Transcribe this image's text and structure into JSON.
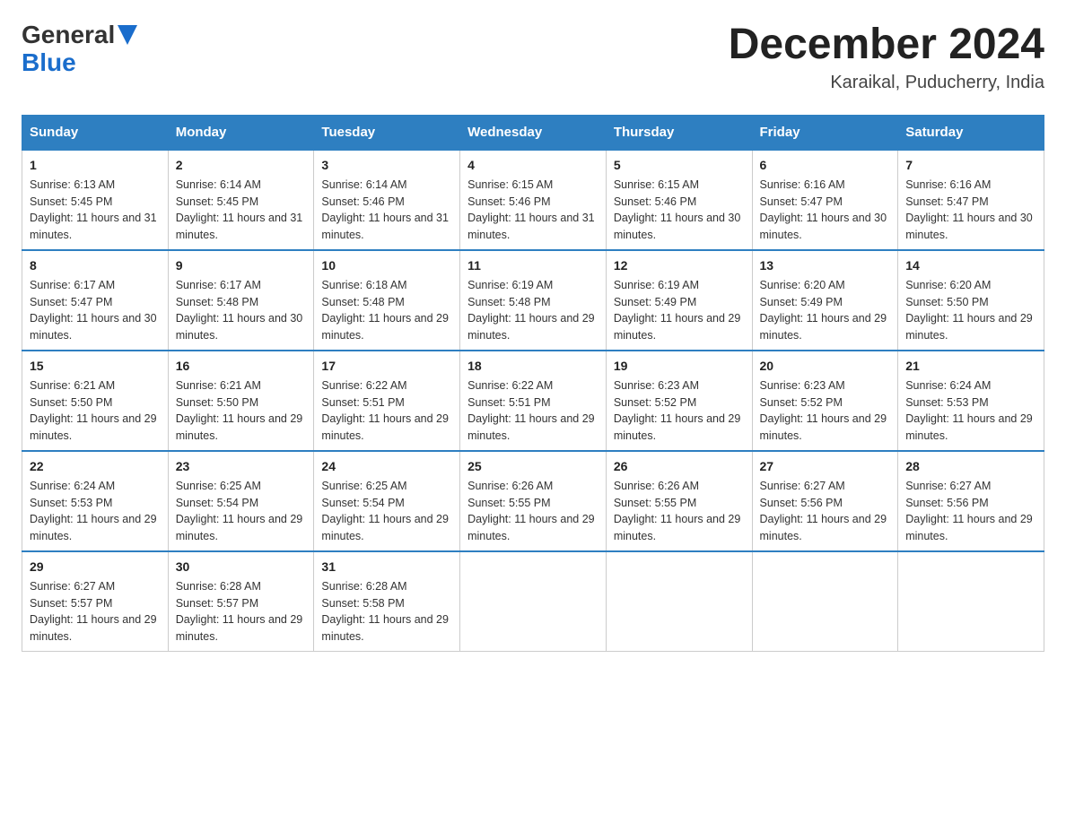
{
  "header": {
    "logo_general": "General",
    "logo_blue": "Blue",
    "month_title": "December 2024",
    "location": "Karaikal, Puducherry, India"
  },
  "days_of_week": [
    "Sunday",
    "Monday",
    "Tuesday",
    "Wednesday",
    "Thursday",
    "Friday",
    "Saturday"
  ],
  "weeks": [
    [
      {
        "day": "1",
        "sunrise": "6:13 AM",
        "sunset": "5:45 PM",
        "daylight": "11 hours and 31 minutes."
      },
      {
        "day": "2",
        "sunrise": "6:14 AM",
        "sunset": "5:45 PM",
        "daylight": "11 hours and 31 minutes."
      },
      {
        "day": "3",
        "sunrise": "6:14 AM",
        "sunset": "5:46 PM",
        "daylight": "11 hours and 31 minutes."
      },
      {
        "day": "4",
        "sunrise": "6:15 AM",
        "sunset": "5:46 PM",
        "daylight": "11 hours and 31 minutes."
      },
      {
        "day": "5",
        "sunrise": "6:15 AM",
        "sunset": "5:46 PM",
        "daylight": "11 hours and 30 minutes."
      },
      {
        "day": "6",
        "sunrise": "6:16 AM",
        "sunset": "5:47 PM",
        "daylight": "11 hours and 30 minutes."
      },
      {
        "day": "7",
        "sunrise": "6:16 AM",
        "sunset": "5:47 PM",
        "daylight": "11 hours and 30 minutes."
      }
    ],
    [
      {
        "day": "8",
        "sunrise": "6:17 AM",
        "sunset": "5:47 PM",
        "daylight": "11 hours and 30 minutes."
      },
      {
        "day": "9",
        "sunrise": "6:17 AM",
        "sunset": "5:48 PM",
        "daylight": "11 hours and 30 minutes."
      },
      {
        "day": "10",
        "sunrise": "6:18 AM",
        "sunset": "5:48 PM",
        "daylight": "11 hours and 29 minutes."
      },
      {
        "day": "11",
        "sunrise": "6:19 AM",
        "sunset": "5:48 PM",
        "daylight": "11 hours and 29 minutes."
      },
      {
        "day": "12",
        "sunrise": "6:19 AM",
        "sunset": "5:49 PM",
        "daylight": "11 hours and 29 minutes."
      },
      {
        "day": "13",
        "sunrise": "6:20 AM",
        "sunset": "5:49 PM",
        "daylight": "11 hours and 29 minutes."
      },
      {
        "day": "14",
        "sunrise": "6:20 AM",
        "sunset": "5:50 PM",
        "daylight": "11 hours and 29 minutes."
      }
    ],
    [
      {
        "day": "15",
        "sunrise": "6:21 AM",
        "sunset": "5:50 PM",
        "daylight": "11 hours and 29 minutes."
      },
      {
        "day": "16",
        "sunrise": "6:21 AM",
        "sunset": "5:50 PM",
        "daylight": "11 hours and 29 minutes."
      },
      {
        "day": "17",
        "sunrise": "6:22 AM",
        "sunset": "5:51 PM",
        "daylight": "11 hours and 29 minutes."
      },
      {
        "day": "18",
        "sunrise": "6:22 AM",
        "sunset": "5:51 PM",
        "daylight": "11 hours and 29 minutes."
      },
      {
        "day": "19",
        "sunrise": "6:23 AM",
        "sunset": "5:52 PM",
        "daylight": "11 hours and 29 minutes."
      },
      {
        "day": "20",
        "sunrise": "6:23 AM",
        "sunset": "5:52 PM",
        "daylight": "11 hours and 29 minutes."
      },
      {
        "day": "21",
        "sunrise": "6:24 AM",
        "sunset": "5:53 PM",
        "daylight": "11 hours and 29 minutes."
      }
    ],
    [
      {
        "day": "22",
        "sunrise": "6:24 AM",
        "sunset": "5:53 PM",
        "daylight": "11 hours and 29 minutes."
      },
      {
        "day": "23",
        "sunrise": "6:25 AM",
        "sunset": "5:54 PM",
        "daylight": "11 hours and 29 minutes."
      },
      {
        "day": "24",
        "sunrise": "6:25 AM",
        "sunset": "5:54 PM",
        "daylight": "11 hours and 29 minutes."
      },
      {
        "day": "25",
        "sunrise": "6:26 AM",
        "sunset": "5:55 PM",
        "daylight": "11 hours and 29 minutes."
      },
      {
        "day": "26",
        "sunrise": "6:26 AM",
        "sunset": "5:55 PM",
        "daylight": "11 hours and 29 minutes."
      },
      {
        "day": "27",
        "sunrise": "6:27 AM",
        "sunset": "5:56 PM",
        "daylight": "11 hours and 29 minutes."
      },
      {
        "day": "28",
        "sunrise": "6:27 AM",
        "sunset": "5:56 PM",
        "daylight": "11 hours and 29 minutes."
      }
    ],
    [
      {
        "day": "29",
        "sunrise": "6:27 AM",
        "sunset": "5:57 PM",
        "daylight": "11 hours and 29 minutes."
      },
      {
        "day": "30",
        "sunrise": "6:28 AM",
        "sunset": "5:57 PM",
        "daylight": "11 hours and 29 minutes."
      },
      {
        "day": "31",
        "sunrise": "6:28 AM",
        "sunset": "5:58 PM",
        "daylight": "11 hours and 29 minutes."
      },
      null,
      null,
      null,
      null
    ]
  ],
  "labels": {
    "sunrise": "Sunrise: ",
    "sunset": "Sunset: ",
    "daylight": "Daylight: "
  }
}
